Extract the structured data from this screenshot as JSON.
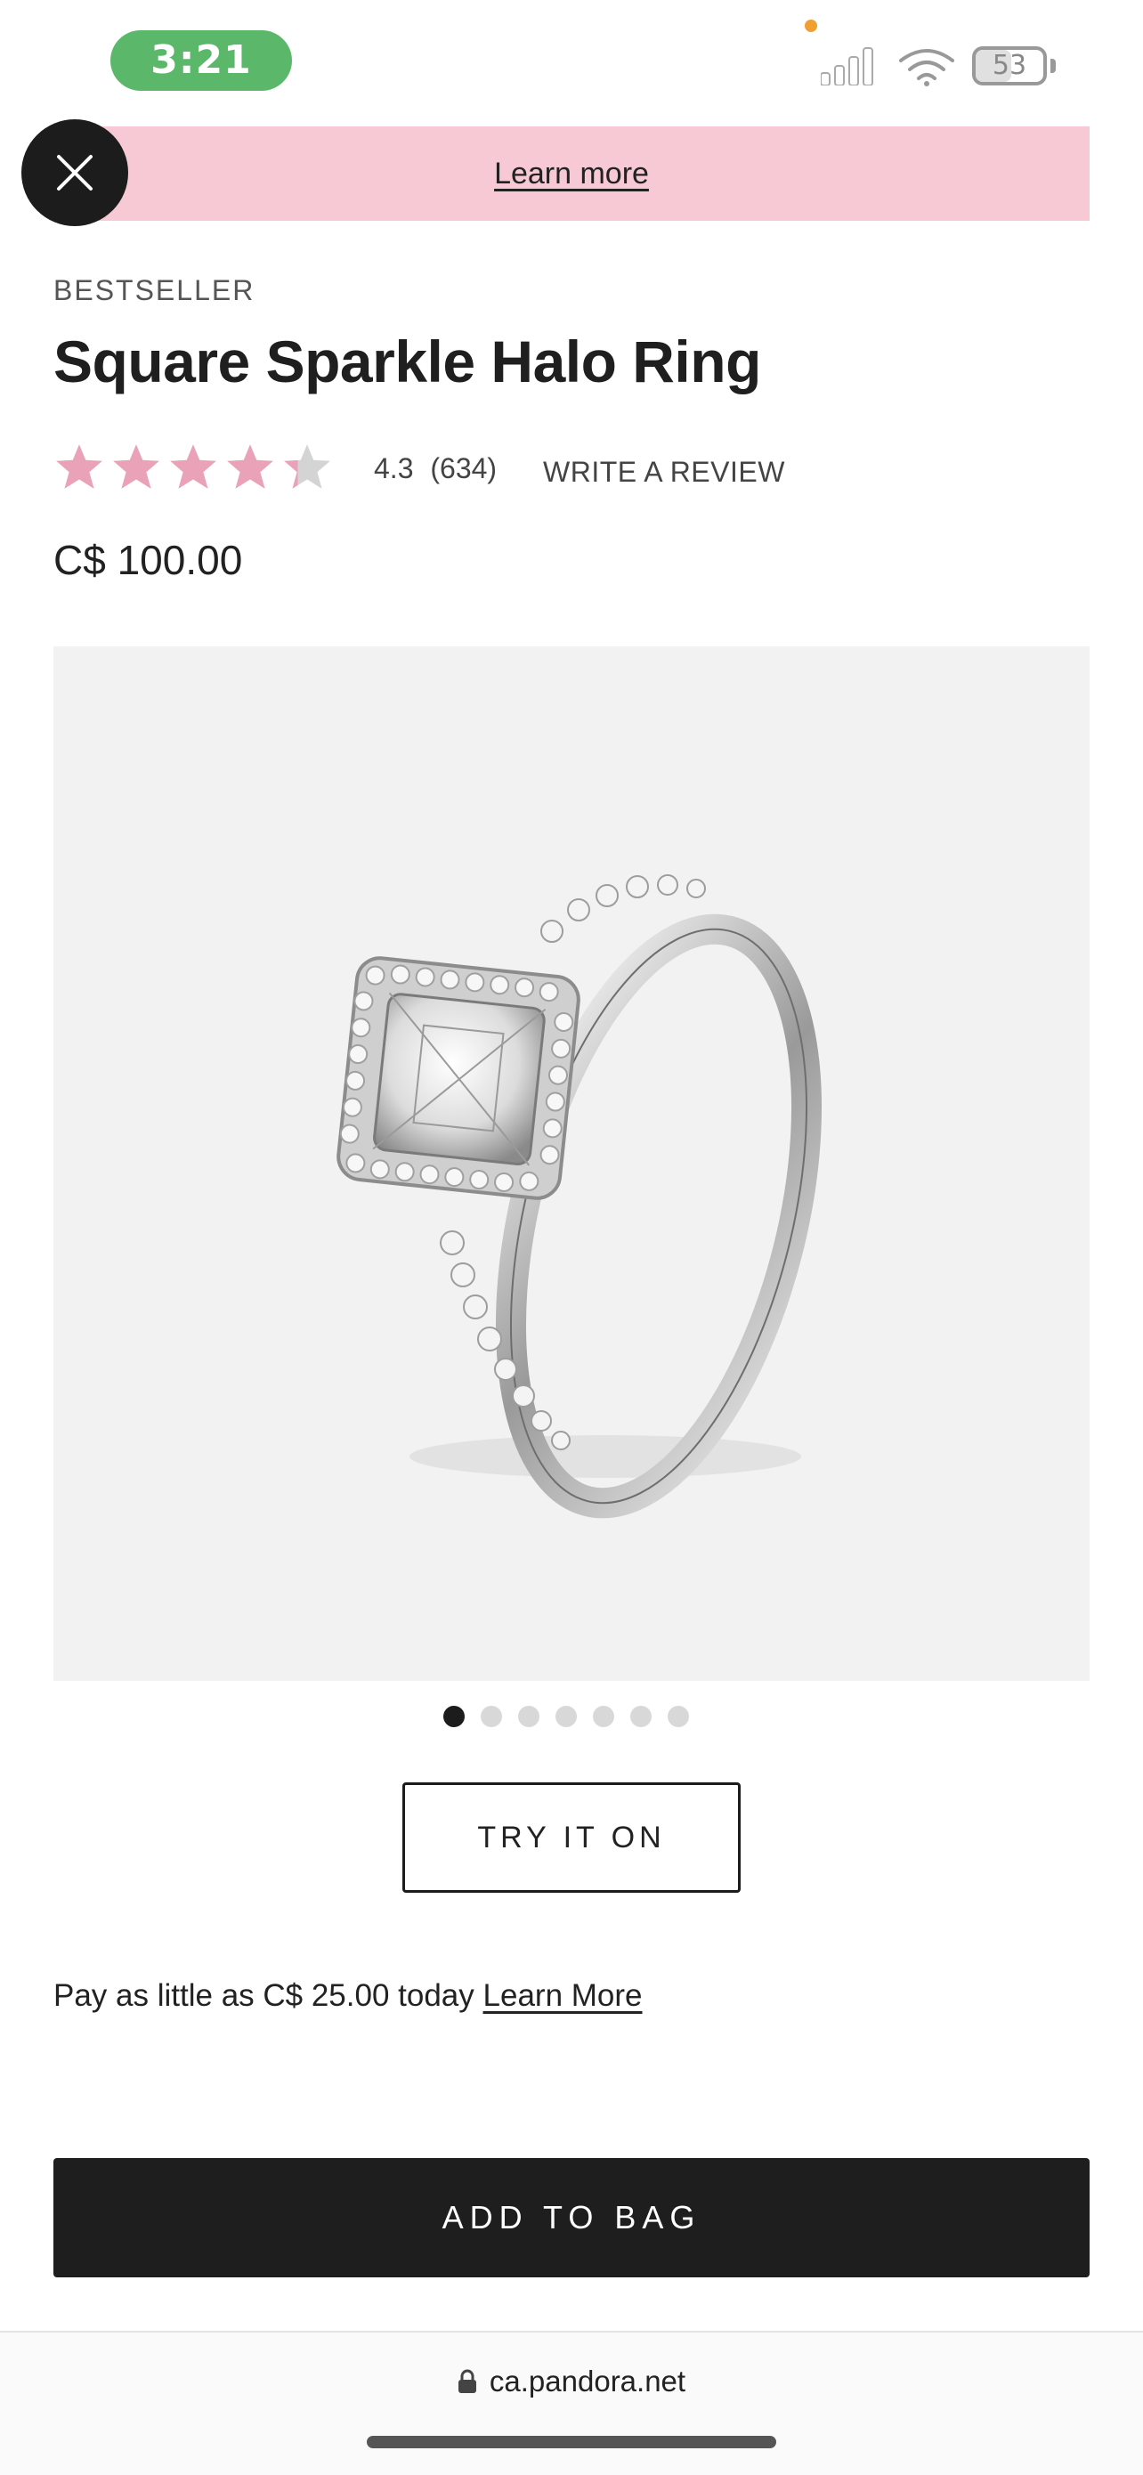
{
  "status_bar": {
    "time": "3:21",
    "battery": "53",
    "battery_level": 0.53
  },
  "banner": {
    "link_label": "Learn more"
  },
  "product": {
    "badge": "BESTSELLER",
    "title": "Square Sparkle Halo Ring",
    "rating": 4.3,
    "rating_text": "4.3",
    "review_count": "(634)",
    "write_review": "WRITE A REVIEW",
    "price": "C$ 100.00"
  },
  "gallery": {
    "image_count": 7,
    "active_index": 0
  },
  "actions": {
    "try_on": "TRY IT ON",
    "pay_text": "Pay as little as C$ 25.00 today",
    "pay_link": "Learn More",
    "add_to_bag": "ADD TO BAG"
  },
  "browser": {
    "url": "ca.pandora.net"
  },
  "colors": {
    "banner_bg": "#f6c9d5",
    "star_filled": "#e9a2b8",
    "star_empty": "#d4d4d4",
    "button_dark": "#1e1e1e"
  }
}
